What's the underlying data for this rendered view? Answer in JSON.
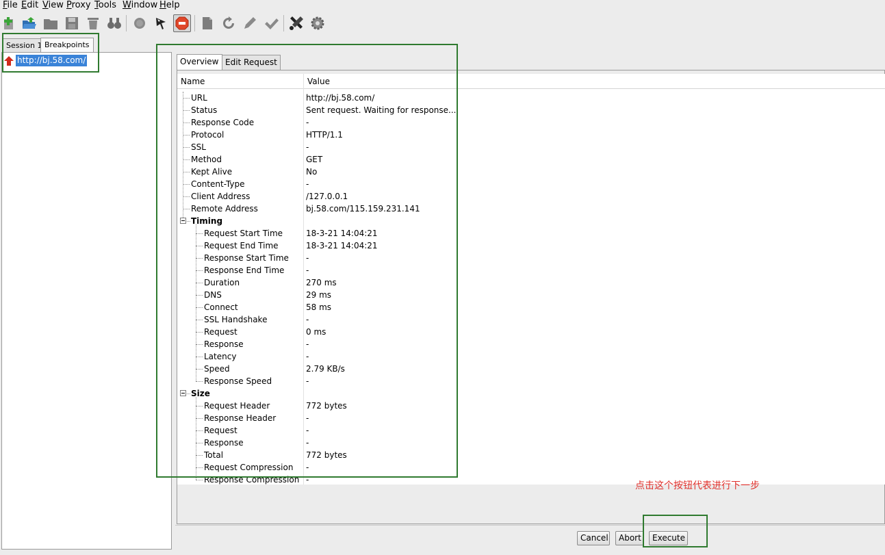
{
  "menu": [
    {
      "label": "File",
      "accel": "F",
      "rest": "ile"
    },
    {
      "label": "Edit",
      "accel": "E",
      "rest": "dit"
    },
    {
      "label": "View",
      "accel": "V",
      "rest": "iew"
    },
    {
      "label": "Proxy",
      "accel": "P",
      "rest": "roxy"
    },
    {
      "label": "Tools",
      "accel": "T",
      "rest": "ools"
    },
    {
      "label": "Window",
      "accel": "W",
      "rest": "indow"
    },
    {
      "label": "Help",
      "accel": "H",
      "rest": "elp"
    }
  ],
  "toolbar": {
    "icons": [
      "new-session-icon",
      "open-icon",
      "folder-icon",
      "save-icon",
      "trash-icon",
      "binoculars-icon",
      "record-icon",
      "clear-flag-icon",
      "stop-breakpoint-icon",
      "edit-icon",
      "repeat-icon",
      "pencil-icon",
      "validate-icon",
      "tools-icon",
      "settings-icon"
    ],
    "breakpoint_color": "#e0472a"
  },
  "left_tabs": [
    "Session 1",
    "Breakpoints"
  ],
  "breakpoint": {
    "url": "http://bj.58.com/",
    "icon": "breakpoint-arrow-icon"
  },
  "right_tabs": [
    "Overview",
    "Edit Request"
  ],
  "table": {
    "headers": [
      "Name",
      "Value"
    ],
    "rows": [
      {
        "name": "URL",
        "value": "http://bj.58.com/"
      },
      {
        "name": "Status",
        "value": "Sent request. Waiting for response..."
      },
      {
        "name": "Response Code",
        "value": "-"
      },
      {
        "name": "Protocol",
        "value": "HTTP/1.1"
      },
      {
        "name": "SSL",
        "value": "-"
      },
      {
        "name": "Method",
        "value": "GET"
      },
      {
        "name": "Kept Alive",
        "value": "No"
      },
      {
        "name": "Content-Type",
        "value": "-"
      },
      {
        "name": "Client Address",
        "value": "/127.0.0.1"
      },
      {
        "name": "Remote Address",
        "value": "bj.58.com/115.159.231.141"
      }
    ],
    "timing": {
      "label": "Timing",
      "rows": [
        {
          "name": "Request Start Time",
          "value": "18-3-21 14:04:21"
        },
        {
          "name": "Request End Time",
          "value": "18-3-21 14:04:21"
        },
        {
          "name": "Response Start Time",
          "value": "-"
        },
        {
          "name": "Response End Time",
          "value": "-"
        },
        {
          "name": "Duration",
          "value": "270 ms"
        },
        {
          "name": "DNS",
          "value": "29 ms"
        },
        {
          "name": "Connect",
          "value": "58 ms"
        },
        {
          "name": "SSL Handshake",
          "value": "-"
        },
        {
          "name": "Request",
          "value": "0 ms"
        },
        {
          "name": "Response",
          "value": "-"
        },
        {
          "name": "Latency",
          "value": "-"
        },
        {
          "name": "Speed",
          "value": "2.79 KB/s"
        },
        {
          "name": "Response Speed",
          "value": "-"
        }
      ]
    },
    "size": {
      "label": "Size",
      "rows": [
        {
          "name": "Request Header",
          "value": "772 bytes"
        },
        {
          "name": "Response Header",
          "value": "-"
        },
        {
          "name": "Request",
          "value": "-"
        },
        {
          "name": "Response",
          "value": "-"
        },
        {
          "name": "Total",
          "value": "772 bytes"
        },
        {
          "name": "Request Compression",
          "value": "-"
        },
        {
          "name": "Response Compression",
          "value": "-"
        }
      ]
    }
  },
  "buttons": {
    "cancel": "Cancel",
    "abort": "Abort",
    "execute": "Execute"
  },
  "annotation": {
    "text": "点击这个按钮代表进行下一步",
    "color": "#e0302b",
    "box_color": "#2f7a2f"
  }
}
